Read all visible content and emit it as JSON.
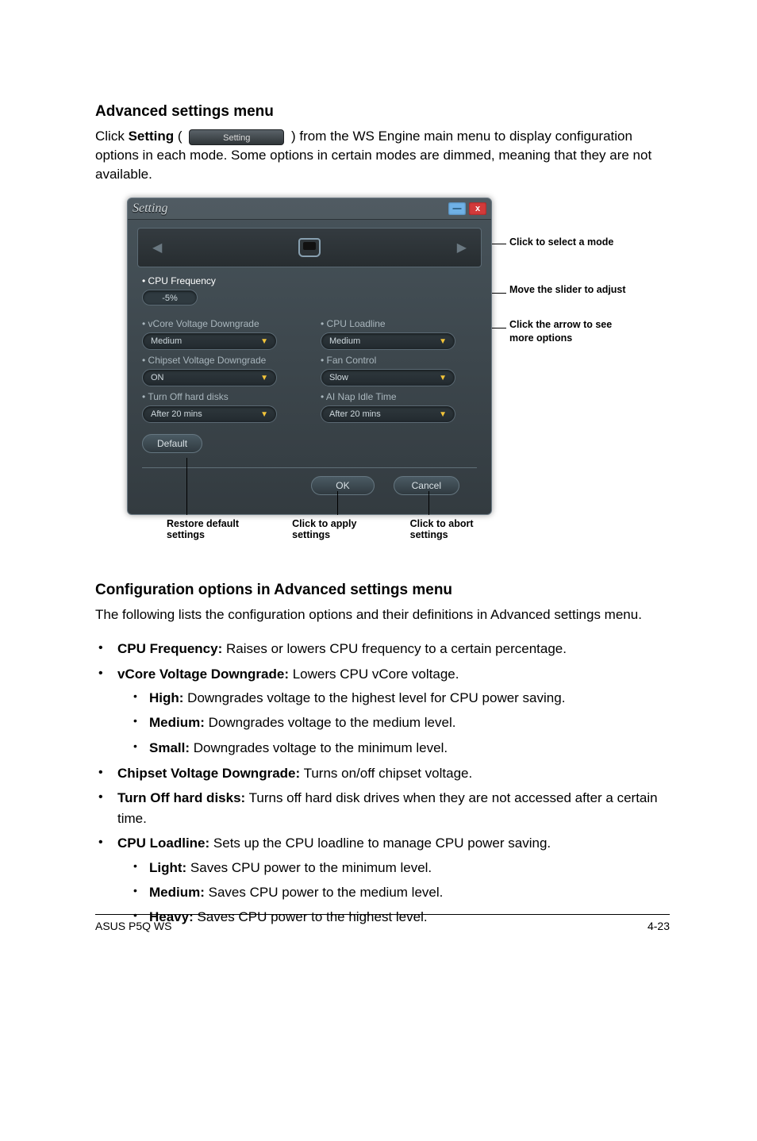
{
  "section1": {
    "heading": "Advanced settings menu",
    "para_pre": "Click ",
    "para_bold": "Setting",
    "para_chip": "Setting",
    "para_after": " ( ",
    "para_rest": " ) from the WS Engine main menu to display configuration options in each mode. Some options in certain modes are dimmed, meaning that they are not available."
  },
  "setting_panel": {
    "title": "Setting",
    "minimize": "—",
    "close": "x",
    "cpu_freq_label": "• CPU Frequency",
    "slider_value": "-5%",
    "left_fields": [
      {
        "label": "• vCore Voltage Downgrade",
        "value": "Medium"
      },
      {
        "label": "• Chipset Voltage Downgrade",
        "value": "ON"
      },
      {
        "label": "• Turn Off hard disks",
        "value": "After 20 mins"
      }
    ],
    "right_fields": [
      {
        "label": "• CPU Loadline",
        "value": "Medium"
      },
      {
        "label": "• Fan Control",
        "value": "Slow"
      },
      {
        "label": "• AI Nap Idle Time",
        "value": "After 20 mins"
      }
    ],
    "default_btn": "Default",
    "ok_btn": "OK",
    "cancel_btn": "Cancel"
  },
  "callouts": {
    "select_mode": "Click to select a mode",
    "slider": "Move the slider to adjust",
    "arrow": "Click the arrow to see more options",
    "restore": "Restore default settings",
    "apply": "Click to apply settings",
    "abort": "Click to abort settings"
  },
  "section2": {
    "heading": "Configuration options in Advanced settings menu",
    "intro": "The following lists the configuration options and their definitions in Advanced settings menu.",
    "items": [
      {
        "name": "CPU Frequency:",
        "desc": " Raises or lowers CPU frequency to a certain percentage."
      },
      {
        "name": "vCore Voltage Downgrade:",
        "desc": " Lowers CPU vCore voltage.",
        "children": [
          {
            "name": "High:",
            "desc": " Downgrades voltage to the highest level for CPU power saving."
          },
          {
            "name": "Medium:",
            "desc": " Downgrades voltage to the medium level."
          },
          {
            "name": "Small:",
            "desc": " Downgrades voltage to the minimum level."
          }
        ]
      },
      {
        "name": "Chipset Voltage Downgrade:",
        "desc": " Turns on/off chipset voltage."
      },
      {
        "name": "Turn Off hard disks:",
        "desc": " Turns off hard disk drives when they are not accessed after a certain time."
      },
      {
        "name": "CPU Loadline:",
        "desc": " Sets up the CPU loadline to manage CPU power saving.",
        "children": [
          {
            "name": "Light:",
            "desc": " Saves CPU power to the minimum level."
          },
          {
            "name": "Medium:",
            "desc": " Saves CPU power to the medium level."
          },
          {
            "name": "Heavy:",
            "desc": " Saves CPU power to the highest level."
          }
        ]
      }
    ]
  },
  "footer": {
    "left": "ASUS P5Q WS",
    "right": "4-23"
  }
}
